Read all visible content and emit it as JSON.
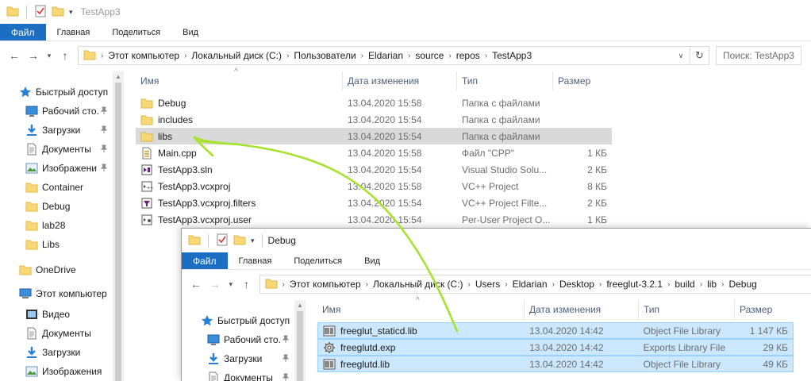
{
  "window1": {
    "title": "TestApp3",
    "menu": {
      "file": "Файл",
      "home": "Главная",
      "share": "Поделиться",
      "view": "Вид"
    },
    "address": {
      "segments": [
        "Этот компьютер",
        "Локальный диск (C:)",
        "Пользователи",
        "Eldarian",
        "source",
        "repos",
        "TestApp3"
      ]
    },
    "search": {
      "placeholder": "Поиск: TestApp3"
    },
    "nav": [
      {
        "label": "Быстрый доступ",
        "icon": "star-icon"
      },
      {
        "label": "Рабочий сто.",
        "icon": "desktop-icon",
        "pinned": true
      },
      {
        "label": "Загрузки",
        "icon": "download-icon",
        "pinned": true
      },
      {
        "label": "Документы",
        "icon": "document-icon",
        "pinned": true
      },
      {
        "label": "Изображени",
        "icon": "pictures-icon",
        "pinned": true
      },
      {
        "label": "Container",
        "icon": "folder-icon"
      },
      {
        "label": "Debug",
        "icon": "folder-icon"
      },
      {
        "label": "lab28",
        "icon": "folder-icon"
      },
      {
        "label": "Libs",
        "icon": "folder-icon"
      },
      {
        "label": "OneDrive",
        "icon": "folder-icon"
      },
      {
        "label": "Этот компьютер",
        "icon": "computer-icon"
      },
      {
        "label": "Видео",
        "icon": "video-icon"
      },
      {
        "label": "Документы",
        "icon": "document-icon"
      },
      {
        "label": "Загрузки",
        "icon": "download-icon"
      },
      {
        "label": "Изображения",
        "icon": "pictures-icon"
      }
    ],
    "columns": {
      "name": "Имя",
      "date": "Дата изменения",
      "type": "Тип",
      "size": "Размер"
    },
    "files": [
      {
        "name": "Debug",
        "date": "13.04.2020 15:58",
        "type": "Папка с файлами",
        "size": "",
        "icon": "folder-icon"
      },
      {
        "name": "includes",
        "date": "13.04.2020 15:54",
        "type": "Папка с файлами",
        "size": "",
        "icon": "folder-icon"
      },
      {
        "name": "libs",
        "date": "13.04.2020 15:54",
        "type": "Папка с файлами",
        "size": "",
        "icon": "folder-icon"
      },
      {
        "name": "Main.cpp",
        "date": "13.04.2020 15:58",
        "type": "Файл \"CPP\"",
        "size": "1 КБ",
        "icon": "cpp-file-icon"
      },
      {
        "name": "TestApp3.sln",
        "date": "13.04.2020 15:54",
        "type": "Visual Studio Solu...",
        "size": "2 КБ",
        "icon": "sln-file-icon"
      },
      {
        "name": "TestApp3.vcxproj",
        "date": "13.04.2020 15:58",
        "type": "VC++ Project",
        "size": "8 КБ",
        "icon": "vcxproj-file-icon"
      },
      {
        "name": "TestApp3.vcxproj.filters",
        "date": "13.04.2020 15:54",
        "type": "VC++ Project Filte...",
        "size": "2 КБ",
        "icon": "filters-file-icon"
      },
      {
        "name": "TestApp3.vcxproj.user",
        "date": "13.04.2020 15:54",
        "type": "Per-User Project O...",
        "size": "1 КБ",
        "icon": "user-file-icon"
      }
    ]
  },
  "window2": {
    "title": "Debug",
    "menu": {
      "file": "Файл",
      "home": "Главная",
      "share": "Поделиться",
      "view": "Вид"
    },
    "address": {
      "segments": [
        "Этот компьютер",
        "Локальный диск (C:)",
        "Users",
        "Eldarian",
        "Desktop",
        "freeglut-3.2.1",
        "build",
        "lib",
        "Debug"
      ]
    },
    "nav": [
      {
        "label": "Быстрый доступ",
        "icon": "star-icon"
      },
      {
        "label": "Рабочий сто.",
        "icon": "desktop-icon",
        "pinned": true
      },
      {
        "label": "Загрузки",
        "icon": "download-icon",
        "pinned": true
      },
      {
        "label": "Документы",
        "icon": "document-icon",
        "pinned": true
      }
    ],
    "columns": {
      "name": "Имя",
      "date": "Дата изменения",
      "type": "Тип",
      "size": "Размер"
    },
    "files": [
      {
        "name": "freeglut_staticd.lib",
        "date": "13.04.2020 14:42",
        "type": "Object File Library",
        "size": "1 147 КБ",
        "icon": "lib-file-icon"
      },
      {
        "name": "freeglutd.exp",
        "date": "13.04.2020 14:42",
        "type": "Exports Library File",
        "size": "29 КБ",
        "icon": "exp-file-icon"
      },
      {
        "name": "freeglutd.lib",
        "date": "13.04.2020 14:42",
        "type": "Object File Library",
        "size": "49 КБ",
        "icon": "lib-file-icon"
      }
    ]
  },
  "colors": {
    "accent": "#1b6ec2",
    "scribble": "#a6e22e",
    "selection": "#cce8ff",
    "hover": "#d9d9d9"
  }
}
